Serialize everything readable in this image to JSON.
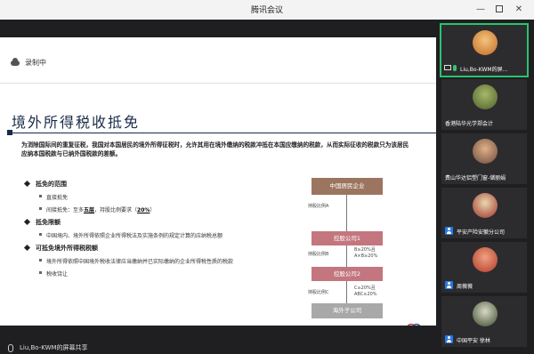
{
  "window": {
    "title": "腾讯会议",
    "controls": [
      "minimize",
      "maximize",
      "close"
    ]
  },
  "recording": {
    "label": "录制中",
    "icon": "cloud-icon"
  },
  "slide": {
    "title": "境外所得税收抵免",
    "intro": "为消除国际间的重复征税，我国对本国居民的境外所得征税时，允许其用在境外缴纳的税款冲抵在本国应缴纳的税款，从而实际征收的税款只为该居民应纳本国税款与已纳外国税款的差额。",
    "sections": [
      {
        "heading": "抵免的范围",
        "items": [
          "直接抵免",
          "间接抵免：至多五层，持股比例要求（20%）"
        ]
      },
      {
        "heading": "抵免限额",
        "items": [
          "中国境内、境外所得依照企业所得税法及实施条例的规定计算的应纳税总额"
        ]
      },
      {
        "heading": "可抵免境外所得税税额",
        "items": [
          "境外所得依照中国境外税收法律应当缴纳并已实际缴纳的企业所得税性质的税款",
          "税收饶让"
        ]
      }
    ],
    "item2_parts": {
      "a": "间接抵免：至多",
      "b": "五层",
      "c": "，持股比例要求（",
      "d": "20%",
      "e": "）"
    },
    "diagram": {
      "top_box": "中国居民企业",
      "holding_a": "持股比例A",
      "sub1": "控股公司1",
      "holding_b": "持股比例B",
      "note_b1": "B≥20%且",
      "note_b2": "A×B≥20%",
      "sub2": "控股公司2",
      "holding_c": "持股比例C",
      "note_c1": "C≥20%且",
      "note_c2": "ABC≥20%",
      "bottom_box": "海外子公司"
    },
    "page_number": "8"
  },
  "share_bar": {
    "label": "Liu,Bo-KWM的屏幕共享"
  },
  "participants": [
    {
      "name": "Liu,Bo-KWM的屏...",
      "active": true,
      "sharing": true,
      "avatar_color": "#d98a3a"
    },
    {
      "name": "香港陆华光学郑会计",
      "active": false,
      "avatar_color": "#7b8f55"
    },
    {
      "name": "费山华达铝塑门窗-储丽娟",
      "active": false,
      "avatar_color": "#b08a6a"
    },
    {
      "name": "平安产险安徽分公司",
      "active": false,
      "avatar_color": "#b0302a"
    },
    {
      "name": "周薇薇",
      "active": false,
      "avatar_color": "#c44b3a"
    },
    {
      "name": "中国平安 徐林",
      "active": false,
      "avatar_color": "#5b6f3a"
    }
  ]
}
